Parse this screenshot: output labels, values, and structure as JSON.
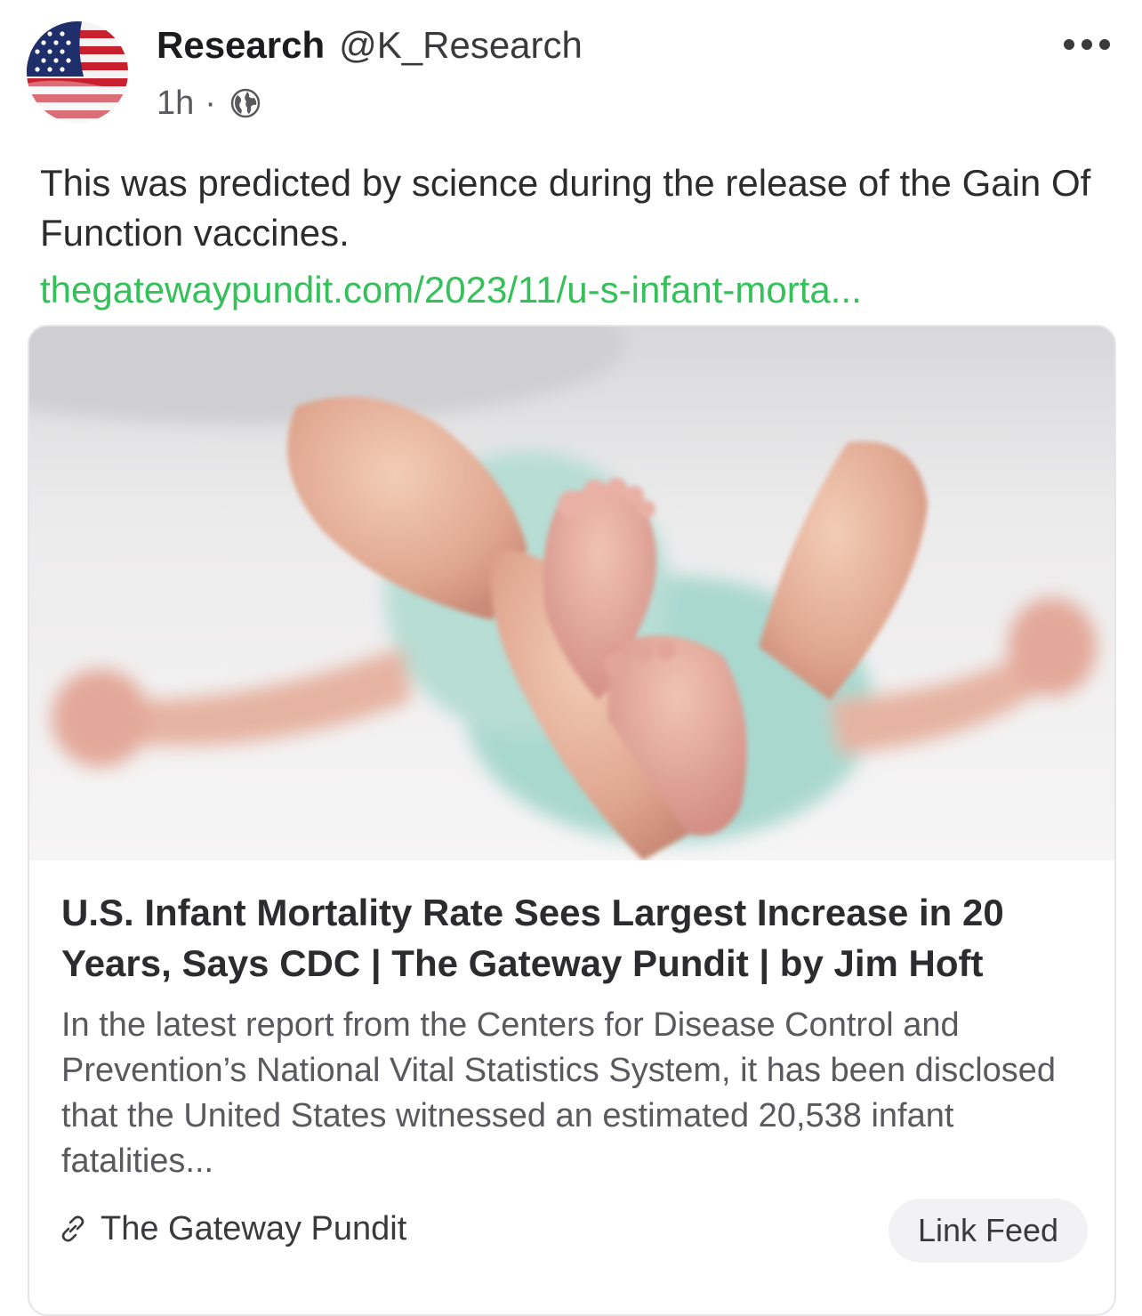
{
  "author": {
    "display_name": "Research",
    "handle": "@K_Research",
    "avatar_icon": "american-flag-icon"
  },
  "meta": {
    "time": "1h",
    "separator": "·",
    "visibility_icon": "globe-icon"
  },
  "menu_icon": "more-options-icon",
  "post": {
    "text": "This was predicted by science during the release of the Gain Of Function vaccines.",
    "link_text": "thegatewaypundit.com/2023/11/u-s-infant-morta..."
  },
  "link_card": {
    "image_icon": "infant-feet-photo",
    "title": "U.S. Infant Mortality Rate Sees Largest Increase in 20 Years, Says CDC | The Gateway Pundit | by Jim Hoft",
    "description": "In the latest report from the Centers for Disease Control and Prevention’s National Vital Statistics System, it has been disclosed that the United States witnessed an estimated 20,538 infant fatalities...",
    "source_icon": "link-icon",
    "source": "The Gateway Pundit",
    "feed_button": "Link Feed"
  },
  "colors": {
    "link": "#34c15a",
    "text": "#2c2c2e",
    "secondary": "#5a5a5e",
    "card_border": "#e5e5ea",
    "button_bg": "#f2f2f4"
  }
}
